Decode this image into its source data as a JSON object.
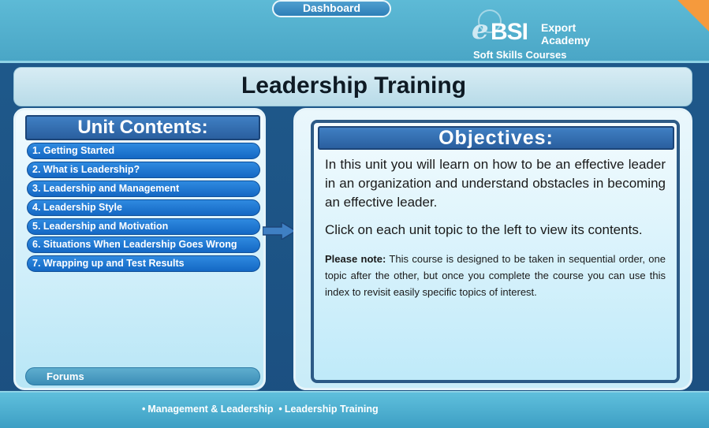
{
  "header": {
    "dashboard_label": "Dashboard",
    "logo": {
      "brand_e": "e",
      "brand_bsi": "BSI",
      "line1": "Export",
      "line2": "Academy",
      "sub": "Soft Skills Courses"
    }
  },
  "title": "Leadership Training",
  "unit_contents": {
    "heading": "Unit Contents:",
    "items": [
      "1. Getting Started",
      "2. What is Leadership?",
      "3. Leadership and Management",
      "4. Leadership Style",
      "5. Leadership and Motivation",
      "6. Situations When Leadership Goes Wrong",
      "7. Wrapping up and Test Results"
    ],
    "forums_label": "Forums"
  },
  "objectives": {
    "heading": "Objectives:",
    "p1": "In this unit you will learn on how to be an effective leader in an organization and understand obstacles in becoming an effective leader.",
    "p2": "Click on each unit topic to the left to view its contents.",
    "note_label": "Please note:",
    "note_text": " This course is designed to be taken in sequential order, one topic after the other, but once you complete the course you can use this index to revisit easily specific topics of interest."
  },
  "footer": {
    "breadcrumbs": [
      "Management & Leadership",
      "Leadership Training"
    ],
    "bullet": "•"
  },
  "colors": {
    "accent_blue": "#1468c4",
    "header_teal": "#4aa6c6",
    "background_navy": "#1f5a8c",
    "corner_orange": "#f59a3d"
  }
}
